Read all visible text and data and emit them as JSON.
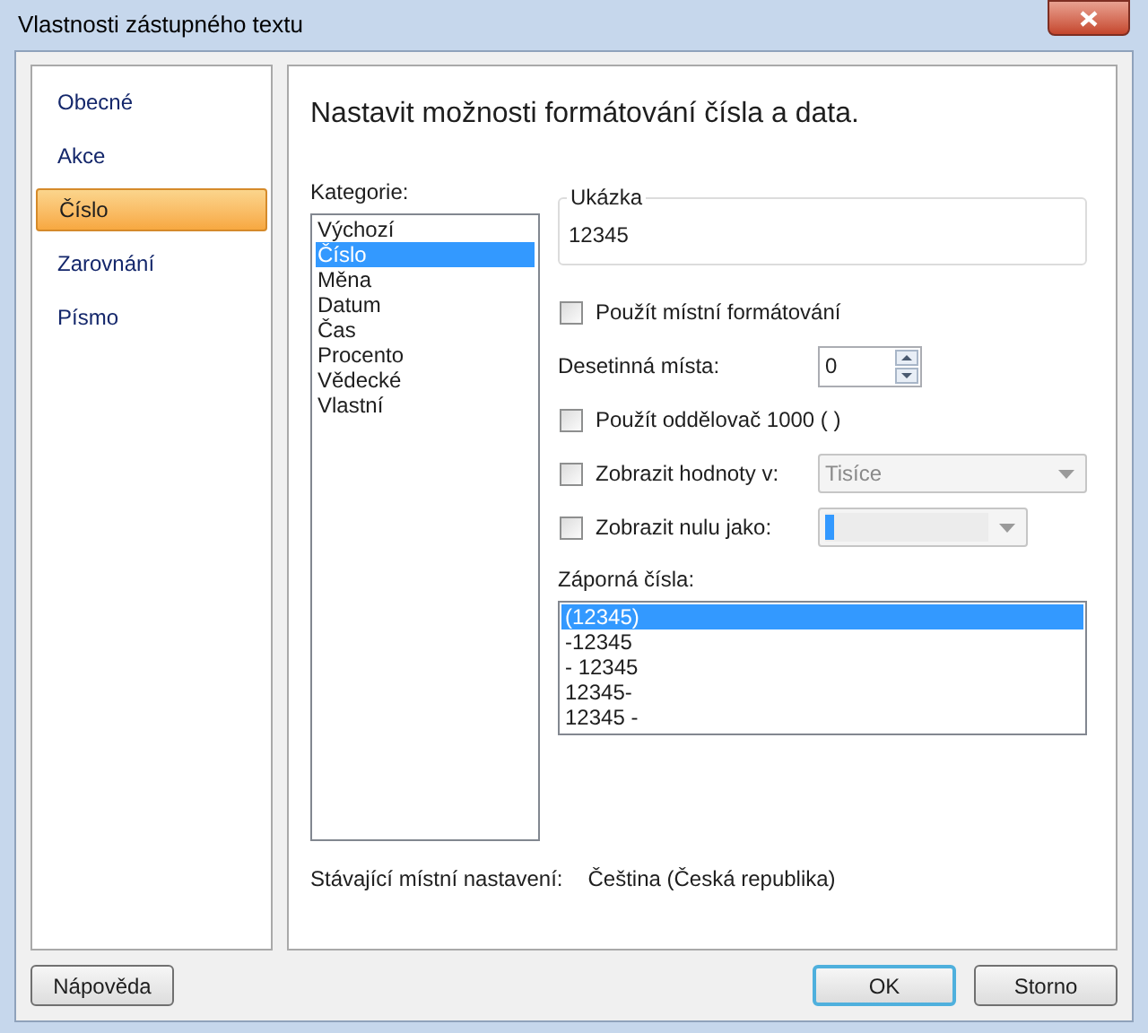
{
  "window": {
    "title": "Vlastnosti zástupného textu"
  },
  "nav": {
    "items": [
      {
        "label": "Obecné",
        "selected": false
      },
      {
        "label": "Akce",
        "selected": false
      },
      {
        "label": "Číslo",
        "selected": true
      },
      {
        "label": "Zarovnání",
        "selected": false
      },
      {
        "label": "Písmo",
        "selected": false
      }
    ]
  },
  "heading": "Nastavit možnosti formátování čísla a data.",
  "category": {
    "label": "Kategorie:",
    "items": [
      {
        "label": "Výchozí",
        "selected": false
      },
      {
        "label": "Číslo",
        "selected": true
      },
      {
        "label": "Měna",
        "selected": false
      },
      {
        "label": "Datum",
        "selected": false
      },
      {
        "label": "Čas",
        "selected": false
      },
      {
        "label": "Procento",
        "selected": false
      },
      {
        "label": "Vědecké",
        "selected": false
      },
      {
        "label": "Vlastní",
        "selected": false
      }
    ]
  },
  "sample": {
    "legend": "Ukázka",
    "value": "12345"
  },
  "options": [
    {
      "kind": "checkbox",
      "label": "Použít místní formátování",
      "checked": false
    },
    {
      "kind": "spin",
      "label": "Desetinná místa:",
      "value": "0"
    },
    {
      "kind": "checkbox",
      "label": "Použít oddělovač 1000 ( )",
      "checked": false
    },
    {
      "kind": "combo",
      "label": "Zobrazit hodnoty v:",
      "checked": false,
      "value": "Tisíce",
      "disabled": true
    },
    {
      "kind": "editcombo",
      "label": "Zobrazit nulu jako:",
      "checked": false,
      "disabled": true
    }
  ],
  "negative": {
    "label": "Záporná čísla:",
    "items": [
      {
        "label": "(12345)",
        "selected": true
      },
      {
        "label": "-12345",
        "selected": false
      },
      {
        "label": "- 12345",
        "selected": false
      },
      {
        "label": "12345-",
        "selected": false
      },
      {
        "label": "12345 -",
        "selected": false
      }
    ]
  },
  "locale": {
    "label": "Stávající místní nastavení:",
    "value": "Čeština (Česká republika)"
  },
  "buttons": [
    {
      "label": "Nápověda",
      "kind": "help",
      "default": false
    },
    {
      "label": "OK",
      "kind": "action",
      "default": true
    },
    {
      "label": "Storno",
      "kind": "action",
      "default": false
    }
  ]
}
